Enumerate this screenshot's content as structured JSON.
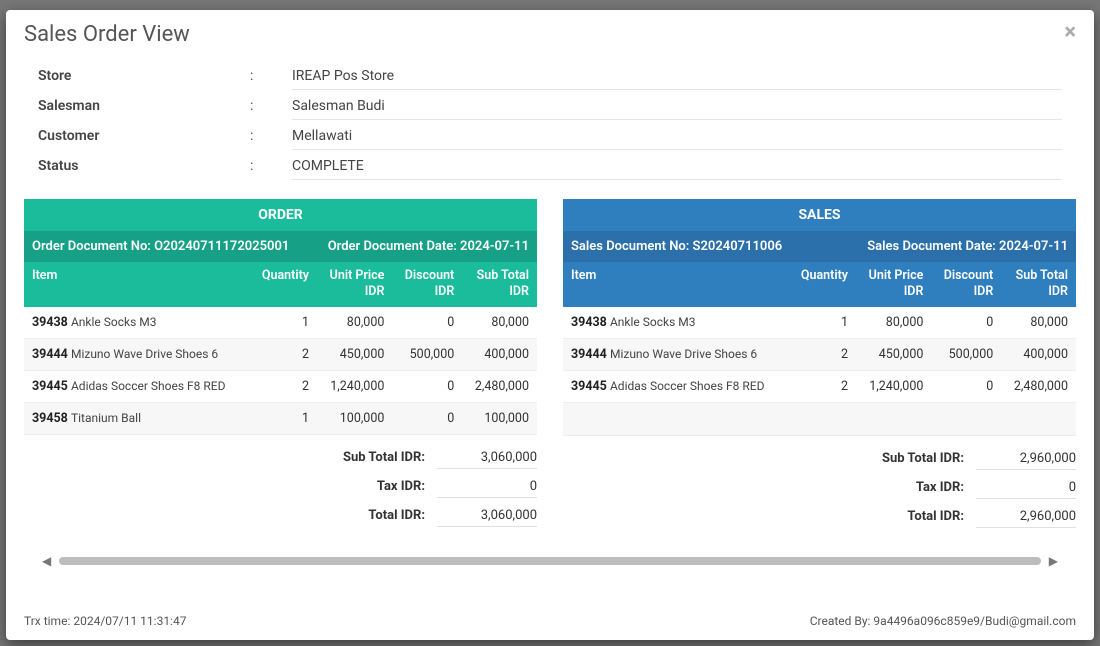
{
  "modal": {
    "title": "Sales Order View"
  },
  "info": {
    "store_label": "Store",
    "store_value": "IREAP Pos Store",
    "salesman_label": "Salesman",
    "salesman_value": "Salesman Budi",
    "customer_label": "Customer",
    "customer_value": "Mellawati",
    "status_label": "Status",
    "status_value": "COMPLETE"
  },
  "order": {
    "section_title": "ORDER",
    "doc_no_label": "Order Document No:",
    "doc_no": "O20240711172025001",
    "doc_date_label": "Order Document Date:",
    "doc_date": "2024-07-11",
    "headers": {
      "item": "Item",
      "qty": "Quantity",
      "unit_price": "Unit Price",
      "unit_price_sub": "IDR",
      "discount": "Discount",
      "discount_sub": "IDR",
      "subtotal": "Sub Total",
      "subtotal_sub": "IDR"
    },
    "rows": [
      {
        "code": "39438",
        "name": "Ankle Socks M3",
        "qty": "1",
        "unit_price": "80,000",
        "discount": "0",
        "subtotal": "80,000"
      },
      {
        "code": "39444",
        "name": "Mizuno Wave Drive Shoes 6",
        "qty": "2",
        "unit_price": "450,000",
        "discount": "500,000",
        "subtotal": "400,000"
      },
      {
        "code": "39445",
        "name": "Adidas Soccer Shoes F8 RED",
        "qty": "2",
        "unit_price": "1,240,000",
        "discount": "0",
        "subtotal": "2,480,000"
      },
      {
        "code": "39458",
        "name": "Titanium Ball",
        "qty": "1",
        "unit_price": "100,000",
        "discount": "0",
        "subtotal": "100,000"
      }
    ],
    "totals": {
      "subtotal_label": "Sub Total IDR:",
      "subtotal_value": "3,060,000",
      "tax_label": "Tax IDR:",
      "tax_value": "0",
      "total_label": "Total IDR:",
      "total_value": "3,060,000"
    }
  },
  "sales": {
    "section_title": "SALES",
    "doc_no_label": "Sales Document No:",
    "doc_no": "S20240711006",
    "doc_date_label": "Sales Document Date:",
    "doc_date": "2024-07-11",
    "headers": {
      "item": "Item",
      "qty": "Quantity",
      "unit_price": "Unit Price",
      "unit_price_sub": "IDR",
      "discount": "Discount",
      "discount_sub": "IDR",
      "subtotal": "Sub Total",
      "subtotal_sub": "IDR"
    },
    "rows": [
      {
        "code": "39438",
        "name": "Ankle Socks M3",
        "qty": "1",
        "unit_price": "80,000",
        "discount": "0",
        "subtotal": "80,000"
      },
      {
        "code": "39444",
        "name": "Mizuno Wave Drive Shoes 6",
        "qty": "2",
        "unit_price": "450,000",
        "discount": "500,000",
        "subtotal": "400,000"
      },
      {
        "code": "39445",
        "name": "Adidas Soccer Shoes F8 RED",
        "qty": "2",
        "unit_price": "1,240,000",
        "discount": "0",
        "subtotal": "2,480,000"
      }
    ],
    "totals": {
      "subtotal_label": "Sub Total IDR:",
      "subtotal_value": "2,960,000",
      "tax_label": "Tax IDR:",
      "tax_value": "0",
      "total_label": "Total IDR:",
      "total_value": "2,960,000"
    }
  },
  "footer": {
    "trx_time_label": "Trx time:",
    "trx_time": "2024/07/11 11:31:47",
    "created_by_label": "Created By:",
    "created_by": "9a4496a096c859e9/Budi@gmail.com"
  }
}
